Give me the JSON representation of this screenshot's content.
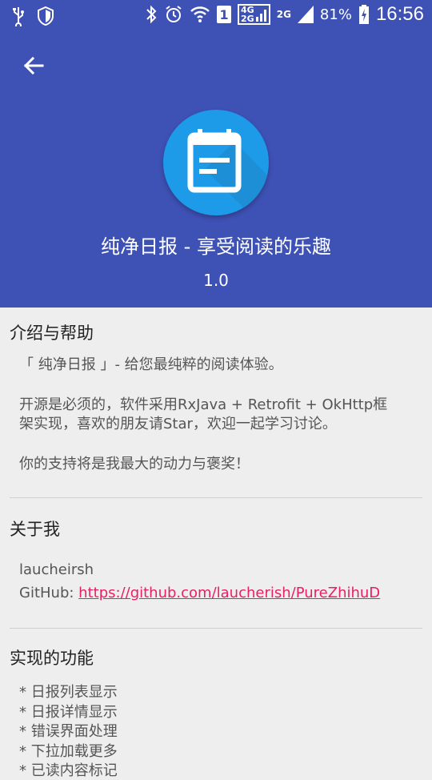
{
  "status_bar": {
    "net_4g": "4G",
    "net_2g_top": "2G",
    "net_2g": "2G",
    "sim": "1",
    "battery": "81%",
    "time": "16:56"
  },
  "header": {
    "app_title": "纯净日报 - 享受阅读的乐趣",
    "version": "1.0"
  },
  "sections": {
    "intro": {
      "title": "介绍与帮助",
      "line1": "「 纯净日报 」- 给您最纯粹的阅读体验。",
      "line2a": "开源是必须的，软件采用RxJava + Retrofit + OkHttp框",
      "line2b": "架实现，喜欢的朋友请Star，欢迎一起学习讨论。",
      "line3": "你的支持将是我最大的动力与褒奖！"
    },
    "about": {
      "title": "关于我",
      "name": "laucheirsh",
      "github_label": "GitHub: ",
      "github_link": "https://github.com/laucherish/PureZhihuD"
    },
    "features": {
      "title": "实现的功能",
      "items": [
        "* 日报列表显示",
        "* 日报详情显示",
        "* 错误界面处理",
        "* 下拉加载更多",
        "* 已读内容标记"
      ]
    }
  },
  "colors": {
    "primary": "#3e51b5",
    "logo_bg": "#1e9be8",
    "link": "#e91e63"
  }
}
